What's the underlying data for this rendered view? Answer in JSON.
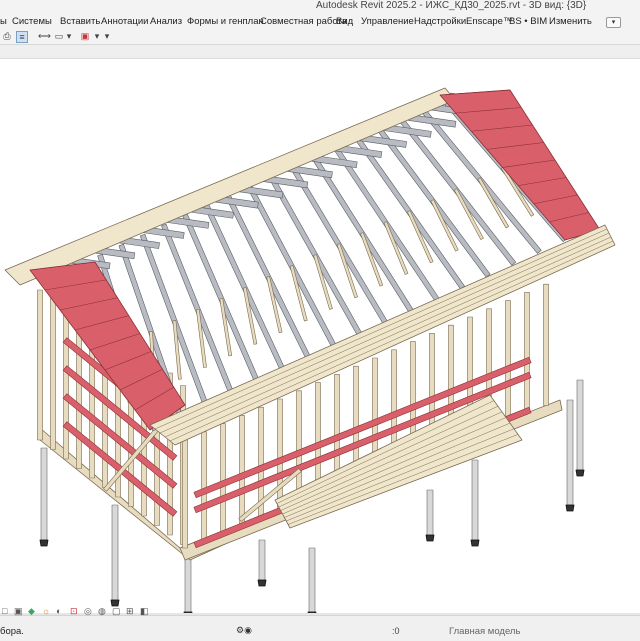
{
  "window": {
    "title": "Autodesk Revit 2025.2 - ИЖС_КД30_2025.rvt - 3D вид: {3D}"
  },
  "ribbon": {
    "tabs": [
      "ы",
      "Системы",
      "Вставить",
      "Аннотации",
      "Анализ",
      "Формы и генплан",
      "Совместная работа",
      "Вид",
      "Управление",
      "Надстройки",
      "Enscape™",
      "BS • BIM",
      "Изменить"
    ]
  },
  "quick_access": {
    "icons": [
      "print-icon",
      "measure-icon",
      "thin-lines-icon",
      "close-hidden-icon",
      "switch-windows-icon",
      "visibility-icon",
      "dropdown-arrow-icon"
    ]
  },
  "options_button": {
    "label": "▾"
  },
  "viewport": {
    "view_name": "3D вид: {3D}"
  },
  "status": {
    "text": "бора.",
    "zero_readout": ":0",
    "model": "Главная модель"
  },
  "colors": {
    "wood": "#e8dcc0",
    "wood_stroke": "#7a6a50",
    "steel": "#b8bcc2",
    "red_element": "#d9606a",
    "red_stroke": "#8a2e36",
    "roof": "#efe6cc"
  }
}
